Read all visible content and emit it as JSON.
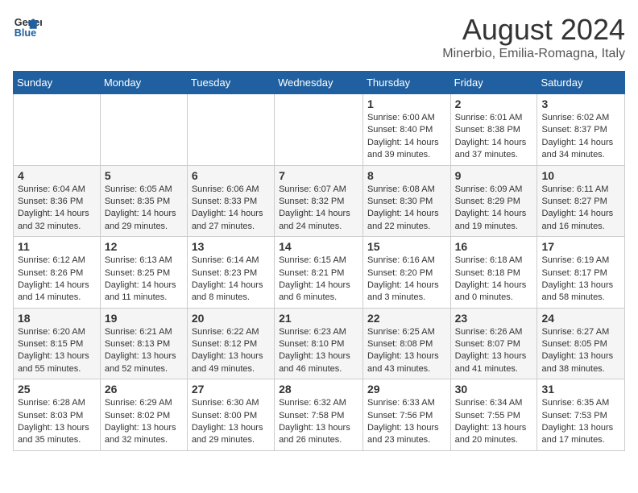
{
  "header": {
    "logo_line1": "General",
    "logo_line2": "Blue",
    "main_title": "August 2024",
    "subtitle": "Minerbio, Emilia-Romagna, Italy"
  },
  "days_of_week": [
    "Sunday",
    "Monday",
    "Tuesday",
    "Wednesday",
    "Thursday",
    "Friday",
    "Saturday"
  ],
  "weeks": [
    [
      {
        "day": "",
        "info": ""
      },
      {
        "day": "",
        "info": ""
      },
      {
        "day": "",
        "info": ""
      },
      {
        "day": "",
        "info": ""
      },
      {
        "day": "1",
        "info": "Sunrise: 6:00 AM\nSunset: 8:40 PM\nDaylight: 14 hours\nand 39 minutes."
      },
      {
        "day": "2",
        "info": "Sunrise: 6:01 AM\nSunset: 8:38 PM\nDaylight: 14 hours\nand 37 minutes."
      },
      {
        "day": "3",
        "info": "Sunrise: 6:02 AM\nSunset: 8:37 PM\nDaylight: 14 hours\nand 34 minutes."
      }
    ],
    [
      {
        "day": "4",
        "info": "Sunrise: 6:04 AM\nSunset: 8:36 PM\nDaylight: 14 hours\nand 32 minutes."
      },
      {
        "day": "5",
        "info": "Sunrise: 6:05 AM\nSunset: 8:35 PM\nDaylight: 14 hours\nand 29 minutes."
      },
      {
        "day": "6",
        "info": "Sunrise: 6:06 AM\nSunset: 8:33 PM\nDaylight: 14 hours\nand 27 minutes."
      },
      {
        "day": "7",
        "info": "Sunrise: 6:07 AM\nSunset: 8:32 PM\nDaylight: 14 hours\nand 24 minutes."
      },
      {
        "day": "8",
        "info": "Sunrise: 6:08 AM\nSunset: 8:30 PM\nDaylight: 14 hours\nand 22 minutes."
      },
      {
        "day": "9",
        "info": "Sunrise: 6:09 AM\nSunset: 8:29 PM\nDaylight: 14 hours\nand 19 minutes."
      },
      {
        "day": "10",
        "info": "Sunrise: 6:11 AM\nSunset: 8:27 PM\nDaylight: 14 hours\nand 16 minutes."
      }
    ],
    [
      {
        "day": "11",
        "info": "Sunrise: 6:12 AM\nSunset: 8:26 PM\nDaylight: 14 hours\nand 14 minutes."
      },
      {
        "day": "12",
        "info": "Sunrise: 6:13 AM\nSunset: 8:25 PM\nDaylight: 14 hours\nand 11 minutes."
      },
      {
        "day": "13",
        "info": "Sunrise: 6:14 AM\nSunset: 8:23 PM\nDaylight: 14 hours\nand 8 minutes."
      },
      {
        "day": "14",
        "info": "Sunrise: 6:15 AM\nSunset: 8:21 PM\nDaylight: 14 hours\nand 6 minutes."
      },
      {
        "day": "15",
        "info": "Sunrise: 6:16 AM\nSunset: 8:20 PM\nDaylight: 14 hours\nand 3 minutes."
      },
      {
        "day": "16",
        "info": "Sunrise: 6:18 AM\nSunset: 8:18 PM\nDaylight: 14 hours\nand 0 minutes."
      },
      {
        "day": "17",
        "info": "Sunrise: 6:19 AM\nSunset: 8:17 PM\nDaylight: 13 hours\nand 58 minutes."
      }
    ],
    [
      {
        "day": "18",
        "info": "Sunrise: 6:20 AM\nSunset: 8:15 PM\nDaylight: 13 hours\nand 55 minutes."
      },
      {
        "day": "19",
        "info": "Sunrise: 6:21 AM\nSunset: 8:13 PM\nDaylight: 13 hours\nand 52 minutes."
      },
      {
        "day": "20",
        "info": "Sunrise: 6:22 AM\nSunset: 8:12 PM\nDaylight: 13 hours\nand 49 minutes."
      },
      {
        "day": "21",
        "info": "Sunrise: 6:23 AM\nSunset: 8:10 PM\nDaylight: 13 hours\nand 46 minutes."
      },
      {
        "day": "22",
        "info": "Sunrise: 6:25 AM\nSunset: 8:08 PM\nDaylight: 13 hours\nand 43 minutes."
      },
      {
        "day": "23",
        "info": "Sunrise: 6:26 AM\nSunset: 8:07 PM\nDaylight: 13 hours\nand 41 minutes."
      },
      {
        "day": "24",
        "info": "Sunrise: 6:27 AM\nSunset: 8:05 PM\nDaylight: 13 hours\nand 38 minutes."
      }
    ],
    [
      {
        "day": "25",
        "info": "Sunrise: 6:28 AM\nSunset: 8:03 PM\nDaylight: 13 hours\nand 35 minutes."
      },
      {
        "day": "26",
        "info": "Sunrise: 6:29 AM\nSunset: 8:02 PM\nDaylight: 13 hours\nand 32 minutes."
      },
      {
        "day": "27",
        "info": "Sunrise: 6:30 AM\nSunset: 8:00 PM\nDaylight: 13 hours\nand 29 minutes."
      },
      {
        "day": "28",
        "info": "Sunrise: 6:32 AM\nSunset: 7:58 PM\nDaylight: 13 hours\nand 26 minutes."
      },
      {
        "day": "29",
        "info": "Sunrise: 6:33 AM\nSunset: 7:56 PM\nDaylight: 13 hours\nand 23 minutes."
      },
      {
        "day": "30",
        "info": "Sunrise: 6:34 AM\nSunset: 7:55 PM\nDaylight: 13 hours\nand 20 minutes."
      },
      {
        "day": "31",
        "info": "Sunrise: 6:35 AM\nSunset: 7:53 PM\nDaylight: 13 hours\nand 17 minutes."
      }
    ]
  ]
}
